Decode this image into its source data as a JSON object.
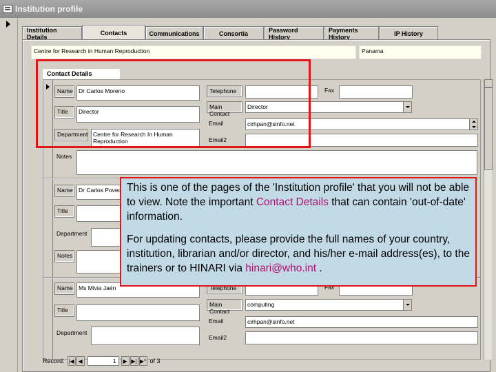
{
  "window": {
    "title": "Institution profile"
  },
  "tabs": [
    {
      "label": "Institution Details",
      "active": false
    },
    {
      "label": "Contacts",
      "active": true
    },
    {
      "label": "Communications",
      "active": false
    },
    {
      "label": "Consortia",
      "active": false
    },
    {
      "label": "Password History",
      "active": false
    },
    {
      "label": "Payments History",
      "active": false
    },
    {
      "label": "IP History",
      "active": false
    }
  ],
  "institution": {
    "name": "Centre for Research in Human Reproduction",
    "country": "Panama"
  },
  "section_title": "Contact Details",
  "labels": {
    "name": "Name",
    "title": "Title",
    "department": "Department",
    "notes": "Notes",
    "telephone": "Telephone",
    "fax": "Fax",
    "main_contact": "Main Contact",
    "email": "Email",
    "email2": "Email2"
  },
  "contacts": [
    {
      "name": "Dr Carlos Moreno",
      "title": "Director",
      "department": "Centre for Research In Human Reproduction",
      "telephone": "",
      "fax": "",
      "main_contact": "Director",
      "email": "cirhpan@sinfo.net",
      "email2": "",
      "notes": ""
    },
    {
      "name": "Dr Carlos Poved",
      "title": "",
      "department": "",
      "notes": ""
    },
    {
      "name": "Ms Mivia Jaén",
      "title": "",
      "department": "",
      "telephone": "",
      "fax": "",
      "main_contact": "computing",
      "email": "cirhpan@sinfo.net",
      "email2": ""
    }
  ],
  "navigation": {
    "record_label": "Record:",
    "current": "1",
    "of_label": "of 3"
  },
  "callout": {
    "p1_a": "This is one of the pages of the 'Institution profile' that you will not be able to view.  Note the important ",
    "p1_accent": "Contact Details",
    "p1_b": " that can contain 'out-of-date' information.",
    "p2_a": "For updating contacts, please provide the full names of your country, institution, librarian and/or director, and his/her e-mail address(es), to the trainers or to HINARI via ",
    "p2_accent": "hinari@who.int",
    "p2_b": " ."
  },
  "colors": {
    "highlight": "#e01515",
    "accent": "#b01070",
    "callout_bg": "#c2d9e6"
  }
}
